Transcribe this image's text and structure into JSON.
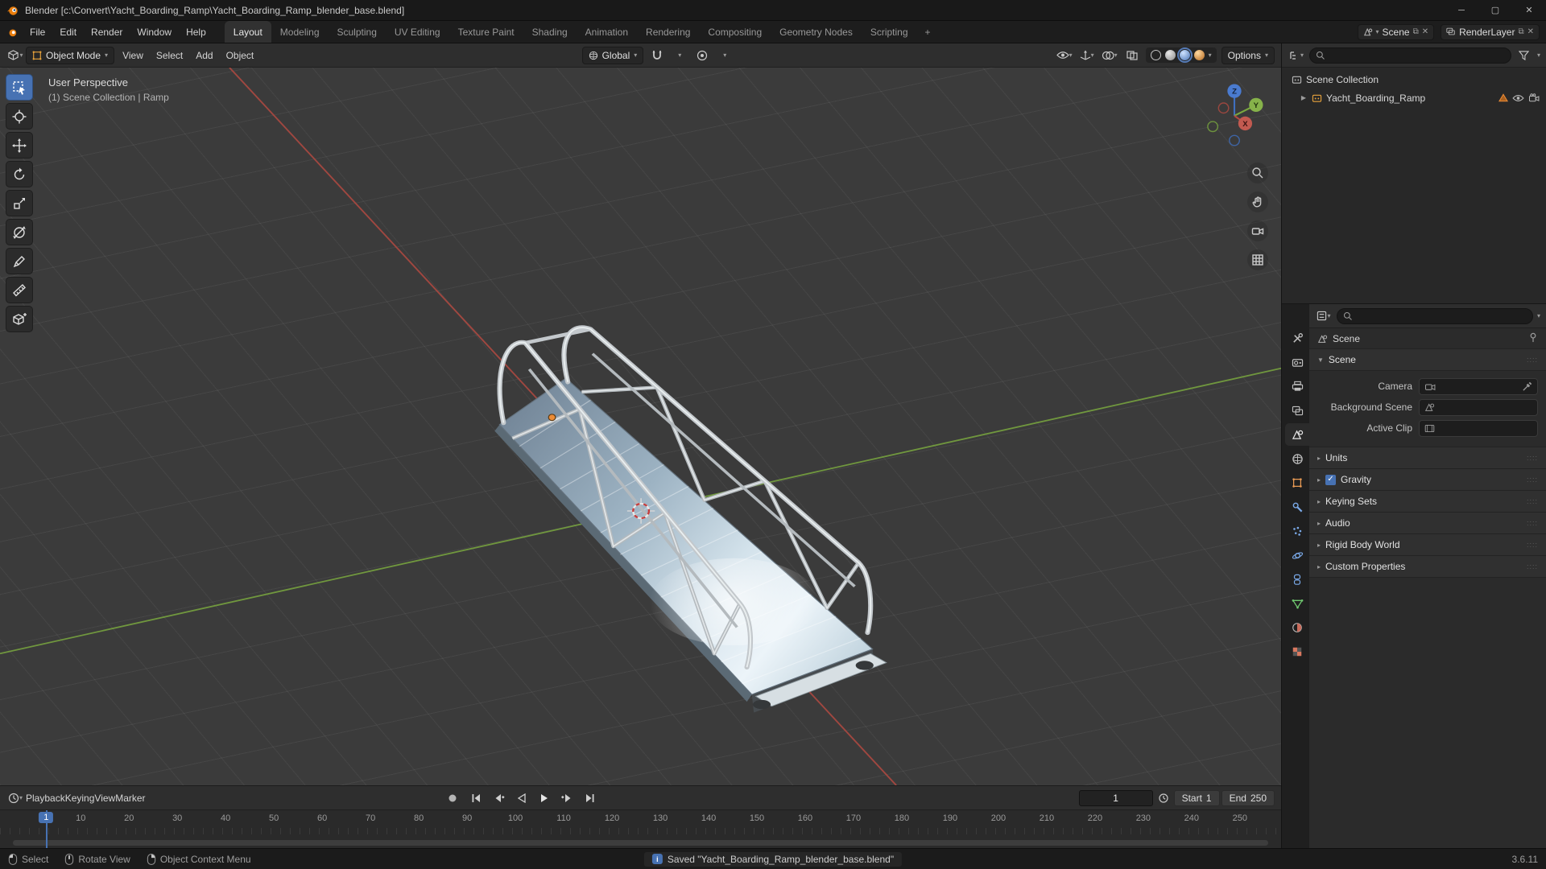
{
  "title_bar": {
    "title": "Blender [c:\\Convert\\Yacht_Boarding_Ramp\\Yacht_Boarding_Ramp_blender_base.blend]"
  },
  "topbar": {
    "menus": [
      "File",
      "Edit",
      "Render",
      "Window",
      "Help"
    ],
    "workspaces": [
      {
        "label": "Layout",
        "active": true
      },
      {
        "label": "Modeling"
      },
      {
        "label": "Sculpting"
      },
      {
        "label": "UV Editing"
      },
      {
        "label": "Texture Paint"
      },
      {
        "label": "Shading"
      },
      {
        "label": "Animation"
      },
      {
        "label": "Rendering"
      },
      {
        "label": "Compositing"
      },
      {
        "label": "Geometry Nodes"
      },
      {
        "label": "Scripting"
      }
    ],
    "add_workspace": "+",
    "scene_selector": {
      "label": "Scene"
    },
    "view_layer_selector": {
      "label": "RenderLayer"
    }
  },
  "viewport": {
    "header": {
      "mode": "Object Mode",
      "menus": [
        "View",
        "Select",
        "Add",
        "Object"
      ],
      "orientation": "Global",
      "options_label": "Options"
    },
    "overlay": {
      "line1": "User Perspective",
      "line2": "(1) Scene Collection | Ramp"
    },
    "gizmo": {
      "x_label": "X",
      "y_label": "Y",
      "z_label": "Z"
    }
  },
  "toolbar": {
    "tools": [
      "box-select",
      "cursor",
      "move",
      "rotate",
      "scale",
      "transform",
      "annotate",
      "measure",
      "add-cube"
    ]
  },
  "outliner": {
    "root_label": "Scene Collection",
    "child_label": "Yacht_Boarding_Ramp"
  },
  "properties": {
    "breadcrumb": "Scene",
    "scene_panel": {
      "title": "Scene",
      "camera_label": "Camera",
      "background_label": "Background Scene",
      "clip_label": "Active Clip"
    },
    "collapsed_panels": [
      {
        "label": "Units"
      },
      {
        "label": "Gravity",
        "checked": true
      },
      {
        "label": "Keying Sets"
      },
      {
        "label": "Audio"
      },
      {
        "label": "Rigid Body World"
      },
      {
        "label": "Custom Properties"
      }
    ]
  },
  "timeline": {
    "menus": [
      "Playback",
      "Keying",
      "View",
      "Marker"
    ],
    "current_frame": "1",
    "start_label": "Start",
    "start_value": "1",
    "end_label": "End",
    "end_value": "250",
    "playhead_label": "1",
    "ruler_frames": [
      "10",
      "20",
      "30",
      "40",
      "50",
      "60",
      "70",
      "80",
      "90",
      "100",
      "110",
      "120",
      "130",
      "140",
      "150",
      "160",
      "170",
      "180",
      "190",
      "200",
      "210",
      "220",
      "230",
      "240",
      "250"
    ]
  },
  "status_bar": {
    "select_label": "Select",
    "rotate_label": "Rotate View",
    "context_label": "Object Context Menu",
    "message": "Saved \"Yacht_Boarding_Ramp_blender_base.blend\"",
    "version": "3.6.11"
  },
  "colors": {
    "accent": "#4772b3",
    "object_orange": "#ec8c36",
    "axis_x": "#b24a41",
    "axis_y": "#7aa83f",
    "axis_z": "#3f6fbf"
  }
}
